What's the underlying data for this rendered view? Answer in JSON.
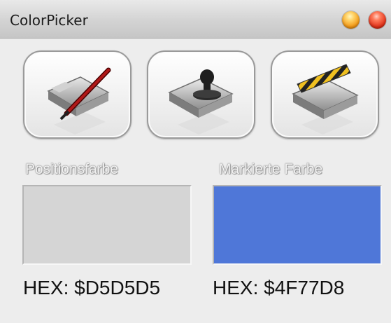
{
  "window": {
    "title": "ColorPicker"
  },
  "controls": {
    "minimize_icon": "minimize-icon",
    "close_icon": "close-icon"
  },
  "toolbar": {
    "buttons": [
      {
        "icon": "folder-pen-icon"
      },
      {
        "icon": "folder-stamp-icon"
      },
      {
        "icon": "folder-clapper-icon"
      }
    ]
  },
  "position_color": {
    "label": "Positionsfarbe",
    "color": "#D5D5D5",
    "hex_text": "HEX: $D5D5D5"
  },
  "marked_color": {
    "label": "Markierte Farbe",
    "color": "#4F77D8",
    "hex_text": "HEX: $4F77D8"
  }
}
